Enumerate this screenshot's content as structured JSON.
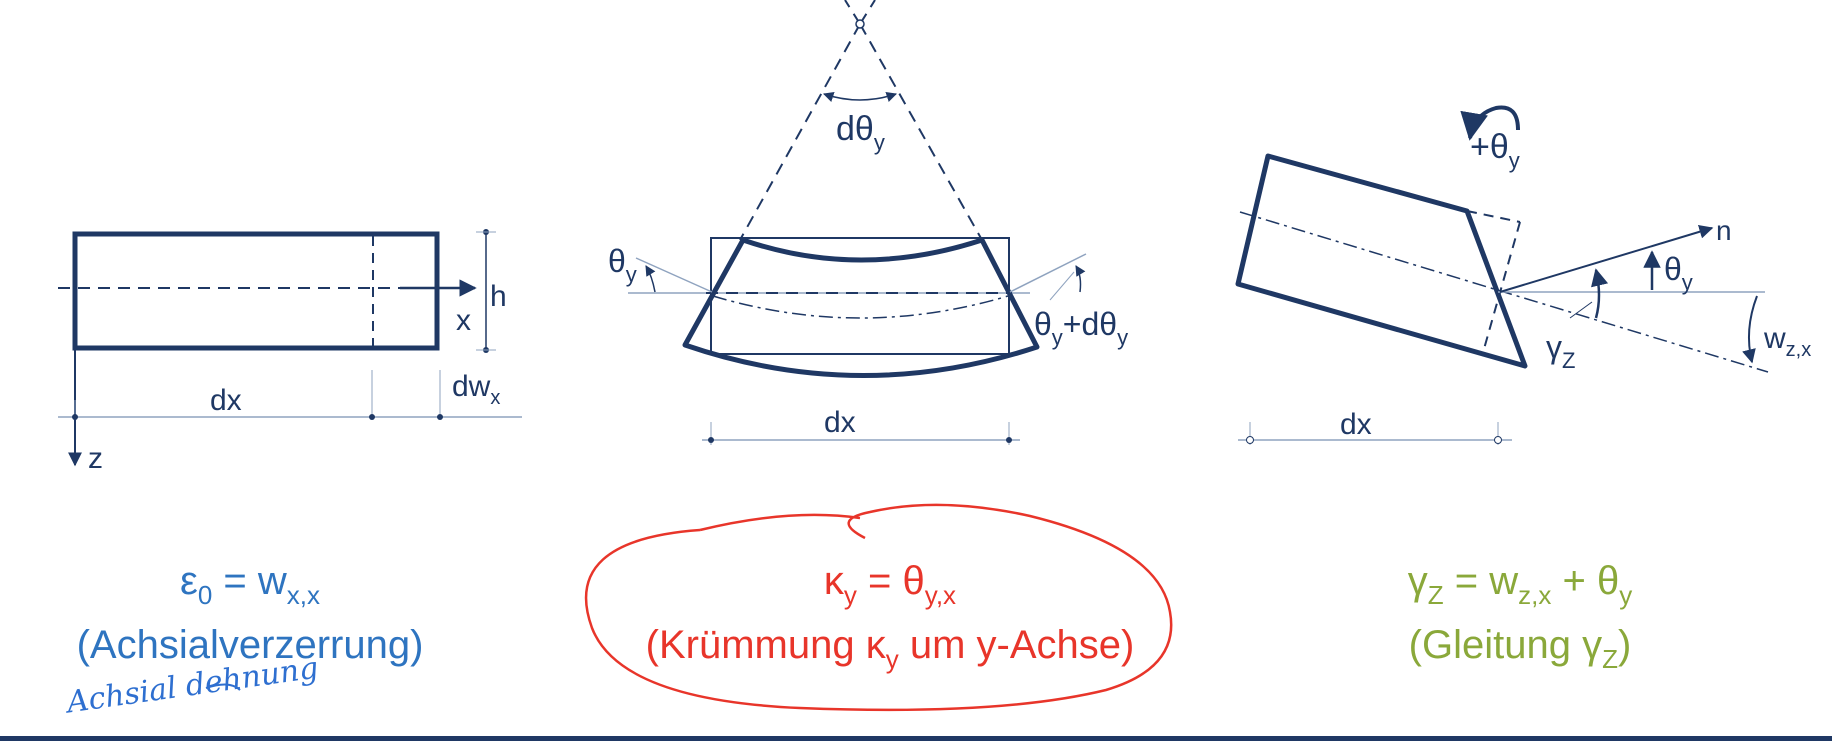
{
  "colors": {
    "navy": "#1f3864",
    "blue": "#2e74c0",
    "red": "#e8352a",
    "green": "#8aa83a",
    "hand_blue": "#2e6fd0"
  },
  "fig1": {
    "x": "x",
    "h": "h",
    "z": "z",
    "dx": "dx",
    "dw_main": "dw",
    "dw_sub": "x"
  },
  "fig2": {
    "dtheta_main": "dθ",
    "dtheta_sub": "y",
    "theta_left_main": "θ",
    "theta_left_sub": "y",
    "theta_right_a": "θ",
    "theta_right_sub": "y",
    "theta_right_b": "+dθ",
    "theta_right_sub2": "y",
    "dx": "dx"
  },
  "fig3": {
    "rot_main": "+θ",
    "rot_sub": "y",
    "n": "n",
    "theta_main": "θ",
    "theta_sub": "y",
    "gamma_main": "γ",
    "gamma_sub": "Z",
    "w_main": "w",
    "w_sub": "z,x",
    "dx": "dx"
  },
  "formula1": {
    "line1_a": "ε",
    "line1_sub": "0",
    "line1_b": " = w",
    "line1_sub2": "x,x",
    "line2": "(Achsialverzerrung)"
  },
  "formula2": {
    "line1_a": "κ",
    "line1_sub": "y",
    "line1_b": " = θ",
    "line1_sub2": "y,x",
    "line2_a": "(Krümmung κ",
    "line2_sub": "y",
    "line2_b": "  um y-Achse)"
  },
  "formula3": {
    "line1_a": "γ",
    "line1_sub": "Z",
    "line1_b": " = w",
    "line1_sub2": "z,x",
    "line1_c": " + θ",
    "line1_sub3": "y",
    "line2_a": "(Gleitung γ",
    "line2_sub": "Z",
    "line2_b": ")"
  },
  "handwritten_note": "Achsial dehnung"
}
